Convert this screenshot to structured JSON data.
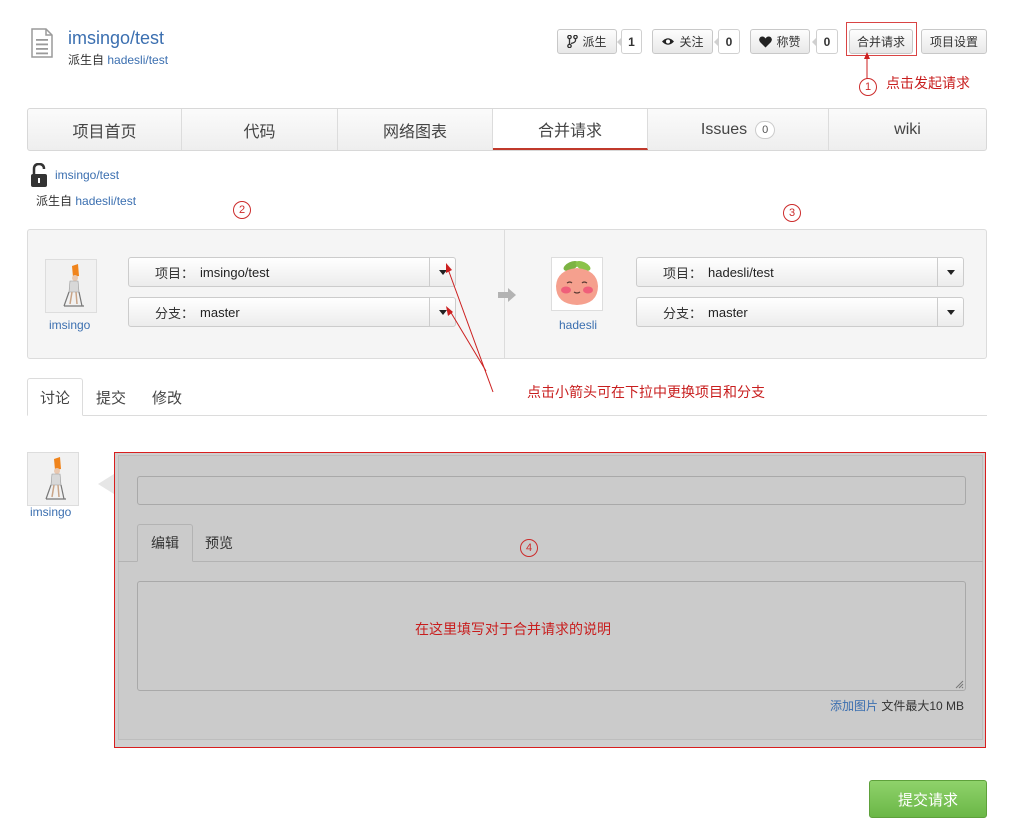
{
  "header": {
    "repo_name": "imsingo/test",
    "forked_from_label": "派生自",
    "forked_from_link": "hadesli/test"
  },
  "actions": {
    "fork_label": "派生",
    "fork_count": "1",
    "watch_label": "关注",
    "watch_count": "0",
    "star_label": "称赞",
    "star_count": "0",
    "merge_request_label": "合并请求",
    "settings_label": "项目设置"
  },
  "annotations": {
    "n1": "1",
    "n2": "2",
    "n3": "3",
    "n4": "4",
    "click_to_start": "点击发起请求",
    "arrow_hint": "点击小箭头可在下拉中更换项目和分支",
    "form_hint": "在这里填写对于合并请求的说明"
  },
  "nav": {
    "tabs": [
      {
        "label": "项目首页"
      },
      {
        "label": "代码"
      },
      {
        "label": "网络图表"
      },
      {
        "label": "合并请求"
      },
      {
        "label": "Issues",
        "badge": "0"
      },
      {
        "label": "wiki"
      }
    ]
  },
  "repo_info": {
    "name": "imsingo/test",
    "forked_from_label": "派生自",
    "forked_from_link": "hadesli/test"
  },
  "compare": {
    "source": {
      "user": "imsingo",
      "project_label": "项目：",
      "project_value": "imsingo/test",
      "branch_label": "分支：",
      "branch_value": "master"
    },
    "target": {
      "user": "hadesli",
      "project_label": "项目：",
      "project_value": "hadesli/test",
      "branch_label": "分支：",
      "branch_value": "master"
    }
  },
  "subtabs": [
    "讨论",
    "提交",
    "修改"
  ],
  "comment": {
    "user": "imsingo",
    "edit_tab": "编辑",
    "preview_tab": "预览",
    "add_image": "添加图片",
    "file_limit": "文件最大10 MB"
  },
  "submit_label": "提交请求",
  "colors": {
    "link": "#3b6fb0",
    "annotation_red": "#cc1f1f",
    "submit_green": "#6bb747",
    "active_tab_underline": "#c0392b"
  }
}
